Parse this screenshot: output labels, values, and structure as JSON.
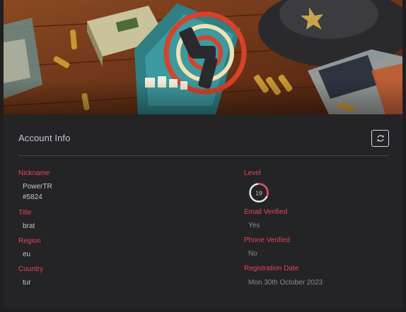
{
  "panel": {
    "title": "Account Info"
  },
  "left_fields": [
    {
      "label": "Nickname",
      "value_line1": "PowerTR",
      "value_line2": "#5824"
    },
    {
      "label": "Title",
      "value": "brat"
    },
    {
      "label": "Region",
      "value": "eu"
    },
    {
      "label": "Country",
      "value": "tur"
    }
  ],
  "right_fields": [
    {
      "label": "Level",
      "value": "19",
      "progress": 0.3
    },
    {
      "label": "Email Verified",
      "value": "Yes"
    },
    {
      "label": "Phone Verified",
      "value": "No"
    },
    {
      "label": "Registration Date",
      "value": "Mon 30th October 2023"
    }
  ],
  "colors": {
    "accent": "#e0485a",
    "background": "#242326",
    "text": "#c8c6cb",
    "muted_text": "#8d8b91"
  },
  "icons": {
    "refresh": "refresh-icon"
  }
}
